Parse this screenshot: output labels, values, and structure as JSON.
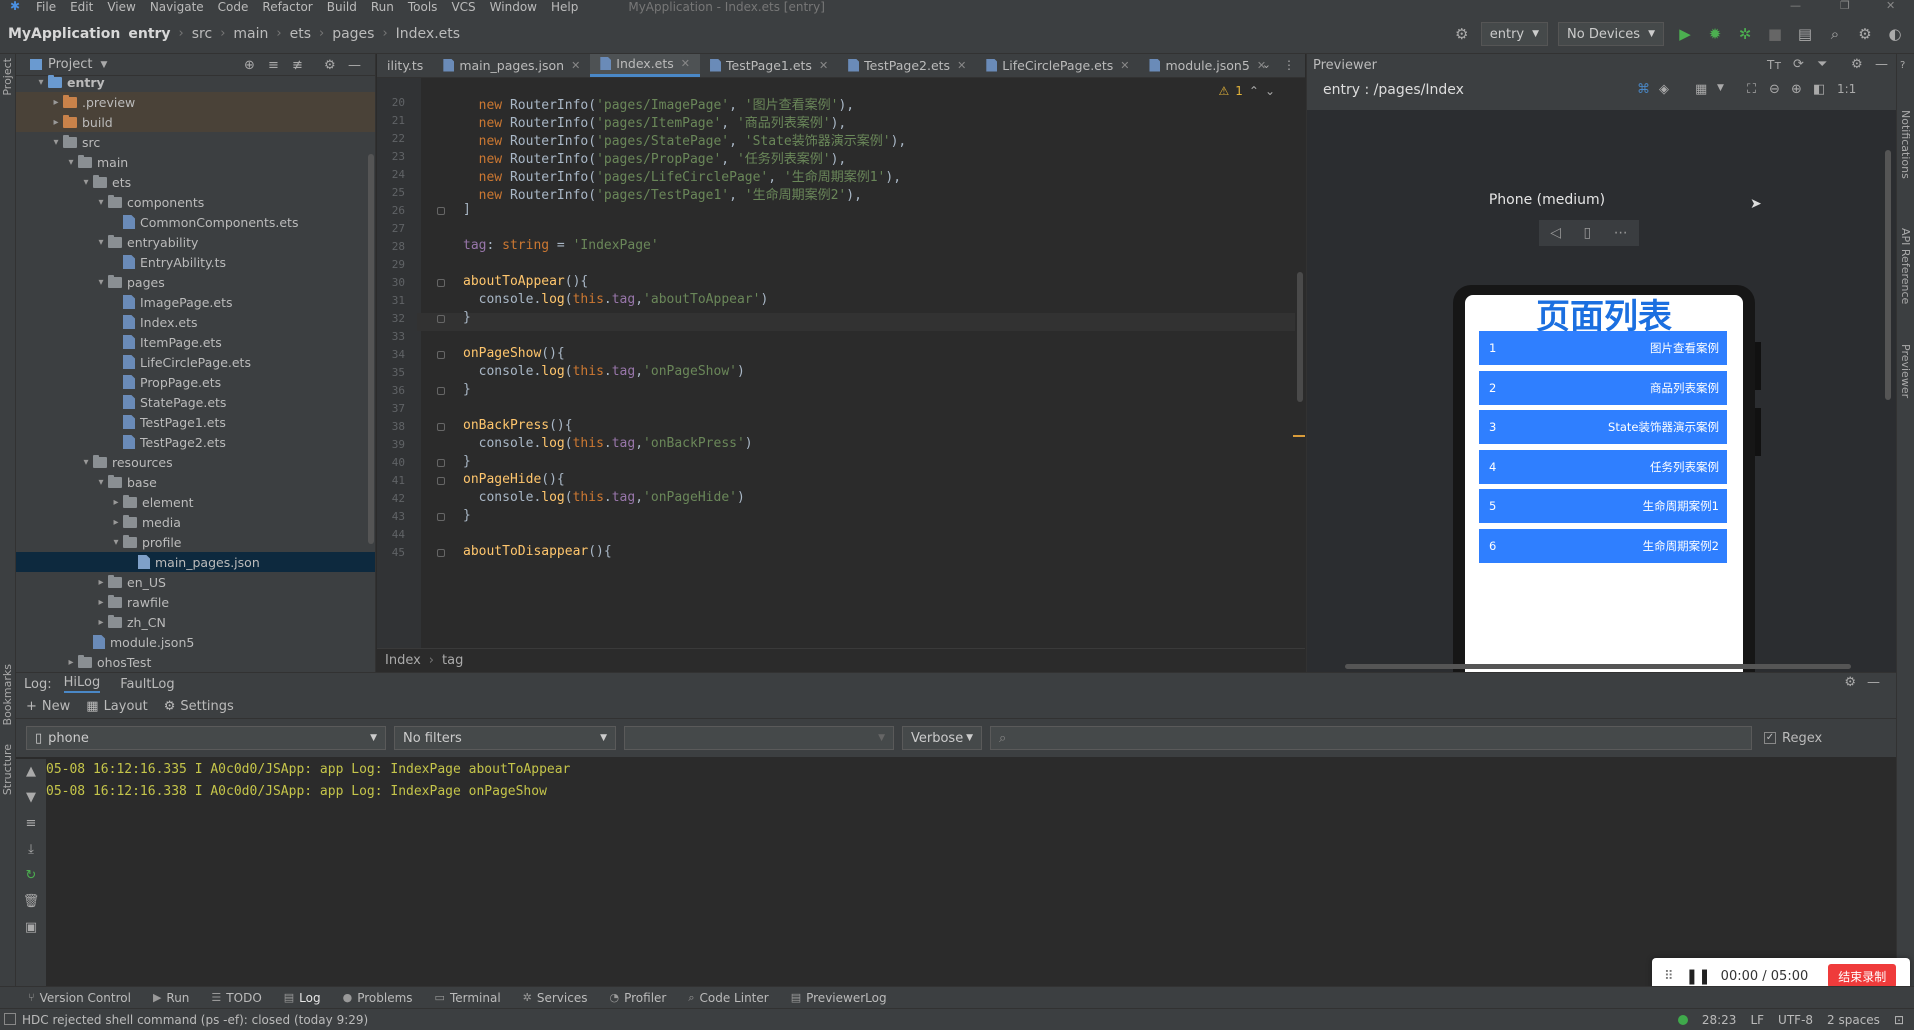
{
  "menubar": {
    "items": [
      "File",
      "Edit",
      "View",
      "Navigate",
      "Code",
      "Refactor",
      "Build",
      "Run",
      "Tools",
      "VCS",
      "Window",
      "Help"
    ],
    "window_title": "MyApplication - Index.ets [entry]"
  },
  "navbar": {
    "crumbs": [
      "MyApplication",
      "entry",
      "src",
      "main",
      "ets",
      "pages",
      "Index.ets"
    ],
    "run_config": "entry",
    "device": "No Devices"
  },
  "project": {
    "title": "Project",
    "tree": [
      {
        "label": "entry",
        "depth": 0,
        "arrow": "▾",
        "icon": "folder"
      },
      {
        "label": ".preview",
        "depth": 1,
        "arrow": "▸",
        "icon": "folder-orange"
      },
      {
        "label": "build",
        "depth": 1,
        "arrow": "▸",
        "icon": "folder-orange"
      },
      {
        "label": "src",
        "depth": 1,
        "arrow": "▾",
        "icon": "folder"
      },
      {
        "label": "main",
        "depth": 2,
        "arrow": "▾",
        "icon": "folder"
      },
      {
        "label": "ets",
        "depth": 3,
        "arrow": "▾",
        "icon": "folder"
      },
      {
        "label": "components",
        "depth": 4,
        "arrow": "▾",
        "icon": "folder"
      },
      {
        "label": "CommonComponents.ets",
        "depth": 5,
        "arrow": "",
        "icon": "file"
      },
      {
        "label": "entryability",
        "depth": 4,
        "arrow": "▾",
        "icon": "folder"
      },
      {
        "label": "EntryAbility.ts",
        "depth": 5,
        "arrow": "",
        "icon": "file"
      },
      {
        "label": "pages",
        "depth": 4,
        "arrow": "▾",
        "icon": "folder"
      },
      {
        "label": "ImagePage.ets",
        "depth": 5,
        "arrow": "",
        "icon": "file"
      },
      {
        "label": "Index.ets",
        "depth": 5,
        "arrow": "",
        "icon": "file"
      },
      {
        "label": "ItemPage.ets",
        "depth": 5,
        "arrow": "",
        "icon": "file"
      },
      {
        "label": "LifeCirclePage.ets",
        "depth": 5,
        "arrow": "",
        "icon": "file"
      },
      {
        "label": "PropPage.ets",
        "depth": 5,
        "arrow": "",
        "icon": "file"
      },
      {
        "label": "StatePage.ets",
        "depth": 5,
        "arrow": "",
        "icon": "file"
      },
      {
        "label": "TestPage1.ets",
        "depth": 5,
        "arrow": "",
        "icon": "file"
      },
      {
        "label": "TestPage2.ets",
        "depth": 5,
        "arrow": "",
        "icon": "file"
      },
      {
        "label": "resources",
        "depth": 3,
        "arrow": "▾",
        "icon": "folder"
      },
      {
        "label": "base",
        "depth": 4,
        "arrow": "▾",
        "icon": "folder"
      },
      {
        "label": "element",
        "depth": 5,
        "arrow": "▸",
        "icon": "folder"
      },
      {
        "label": "media",
        "depth": 5,
        "arrow": "▸",
        "icon": "folder"
      },
      {
        "label": "profile",
        "depth": 5,
        "arrow": "▾",
        "icon": "folder"
      },
      {
        "label": "main_pages.json",
        "depth": 6,
        "arrow": "",
        "icon": "json",
        "selected": true
      },
      {
        "label": "en_US",
        "depth": 4,
        "arrow": "▸",
        "icon": "folder"
      },
      {
        "label": "rawfile",
        "depth": 4,
        "arrow": "▸",
        "icon": "folder"
      },
      {
        "label": "zh_CN",
        "depth": 4,
        "arrow": "▸",
        "icon": "folder"
      },
      {
        "label": "module.json5",
        "depth": 3,
        "arrow": "",
        "icon": "file"
      },
      {
        "label": "ohosTest",
        "depth": 2,
        "arrow": "▸",
        "icon": "folder"
      }
    ]
  },
  "editor": {
    "tabs": [
      "ility.ts",
      "main_pages.json",
      "Index.ets",
      "TestPage1.ets",
      "TestPage2.ets",
      "LifeCirclePage.ets",
      "module.json5"
    ],
    "active_tab": 2,
    "warning_count": "1",
    "breadcrumb": [
      "Index",
      "tag"
    ],
    "lines": [
      {
        "n": "20",
        "text": "  new RouterInfo('pages/ImagePage', '图片查看案例'),"
      },
      {
        "n": "21",
        "text": "  new RouterInfo('pages/ItemPage', '商品列表案例'),"
      },
      {
        "n": "22",
        "text": "  new RouterInfo('pages/StatePage', 'State装饰器演示案例'),"
      },
      {
        "n": "23",
        "text": "  new RouterInfo('pages/PropPage', '任务列表案例'),"
      },
      {
        "n": "24",
        "text": "  new RouterInfo('pages/LifeCirclePage', '生命周期案例1'),"
      },
      {
        "n": "25",
        "text": "  new RouterInfo('pages/TestPage1', '生命周期案例2'),"
      },
      {
        "n": "26",
        "text": "]"
      },
      {
        "n": "27",
        "text": ""
      },
      {
        "n": "28",
        "text": "tag: string = 'IndexPage'"
      },
      {
        "n": "29",
        "text": ""
      },
      {
        "n": "30",
        "text": "aboutToAppear(){"
      },
      {
        "n": "31",
        "text": "  console.log(this.tag,'aboutToAppear')"
      },
      {
        "n": "32",
        "text": "}"
      },
      {
        "n": "33",
        "text": ""
      },
      {
        "n": "34",
        "text": "onPageShow(){"
      },
      {
        "n": "35",
        "text": "  console.log(this.tag,'onPageShow')"
      },
      {
        "n": "36",
        "text": "}"
      },
      {
        "n": "37",
        "text": ""
      },
      {
        "n": "38",
        "text": "onBackPress(){"
      },
      {
        "n": "39",
        "text": "  console.log(this.tag,'onBackPress')"
      },
      {
        "n": "40",
        "text": "}"
      },
      {
        "n": "41",
        "text": "onPageHide(){"
      },
      {
        "n": "42",
        "text": "  console.log(this.tag,'onPageHide')"
      },
      {
        "n": "43",
        "text": "}"
      },
      {
        "n": "44",
        "text": ""
      },
      {
        "n": "45",
        "text": "aboutToDisappear(){"
      }
    ]
  },
  "previewer": {
    "title": "Previewer",
    "route": "entry : /pages/Index",
    "device_name": "Phone (medium)",
    "page_title": "页面列表",
    "items": [
      {
        "num": "1",
        "label": "图片查看案例"
      },
      {
        "num": "2",
        "label": "商品列表案例"
      },
      {
        "num": "3",
        "label": "State装饰器演示案例"
      },
      {
        "num": "4",
        "label": "任务列表案例"
      },
      {
        "num": "5",
        "label": "生命周期案例1"
      },
      {
        "num": "6",
        "label": "生命周期案例2"
      }
    ]
  },
  "right_stripe": [
    "Notifications",
    "API Reference",
    "Previewer"
  ],
  "left_stripe": [
    "Project",
    "Bookmarks",
    "Structure"
  ],
  "log": {
    "label": "Log:",
    "tabs": [
      "HiLog",
      "FaultLog"
    ],
    "toolbar": [
      "New",
      "Layout",
      "Settings"
    ],
    "device": "phone",
    "filter": "No filters",
    "level": "Verbose",
    "regex_label": "Regex",
    "lines": [
      "05-08 16:12:16.335 I A0c0d0/JSApp: app Log: IndexPage aboutToAppear",
      "05-08 16:12:16.338 I A0c0d0/JSApp: app Log: IndexPage onPageShow"
    ]
  },
  "recording": {
    "time": "00:00 / 05:00",
    "stop_label": "结束录制"
  },
  "toolstrip": [
    "Version Control",
    "Run",
    "TODO",
    "Log",
    "Problems",
    "Terminal",
    "Services",
    "Profiler",
    "Code Linter",
    "PreviewerLog"
  ],
  "statusbar": {
    "message": "HDC rejected shell command (ps -ef): closed (today 9:29)",
    "position": "28:23",
    "line_sep": "LF",
    "encoding": "UTF-8",
    "indent": "2 spaces"
  },
  "colors": {
    "accent": "#4a88c7",
    "phone_title": "#1b6fe0",
    "phone_item": "#2f7fff",
    "log_text": "#c5c54a",
    "stop_button": "#ef3b3b"
  }
}
